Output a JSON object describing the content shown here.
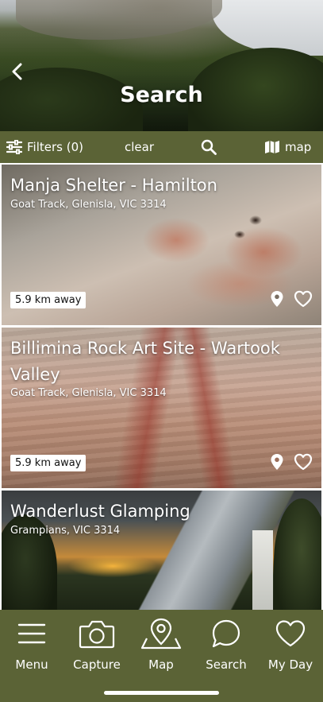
{
  "header": {
    "title": "Search",
    "back_icon": "chevron-left-icon"
  },
  "filter_bar": {
    "filters_label": "Filters (0)",
    "clear_label": "clear",
    "map_label": "map",
    "filters_icon": "sliders-icon",
    "search_icon": "search-icon",
    "map_icon": "folded-map-icon"
  },
  "results": [
    {
      "title": "Manja Shelter - Hamilton",
      "address": "Goat Track, Glenisla, VIC 3314",
      "distance": "5.9 km away"
    },
    {
      "title": "Billimina Rock Art Site - Wartook Valley",
      "address": "Goat Track, Glenisla, VIC 3314",
      "distance": "5.9 km away"
    },
    {
      "title": "Wanderlust Glamping",
      "address": "Grampians, VIC 3314"
    }
  ],
  "bottom_nav": [
    {
      "label": "Menu",
      "icon": "hamburger-menu-icon"
    },
    {
      "label": "Capture",
      "icon": "camera-icon"
    },
    {
      "label": "Map",
      "icon": "map-pin-icon"
    },
    {
      "label": "Search",
      "icon": "speech-bubble-icon"
    },
    {
      "label": "My Day",
      "icon": "heart-icon"
    }
  ],
  "colors": {
    "accent_olive": "#5b6336",
    "text_on_accent": "#ffffff"
  }
}
